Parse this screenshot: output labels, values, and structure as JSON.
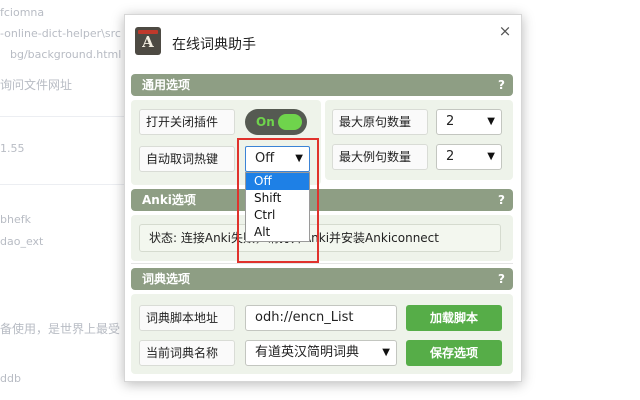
{
  "background": {
    "lines": [
      "fciomna",
      "-online-dict-helper\\src",
      "bg/background.html",
      "询问文件网址",
      "1.55",
      "bhefk",
      "dao_ext",
      "备使用，是世界上最受",
      "ddb"
    ]
  },
  "popup": {
    "title": "在线词典助手",
    "app_icon_letter": "A",
    "close_glyph": "×"
  },
  "general": {
    "title": "通用选项",
    "help": "?",
    "toggle_label": "打开关闭插件",
    "toggle_state": "On",
    "hotkey_label": "自动取词热键",
    "hotkey_value": "Off",
    "hotkey_options": [
      "Off",
      "Shift",
      "Ctrl",
      "Alt"
    ],
    "max_sense_label": "最大原句数量",
    "max_sense_value": "2",
    "max_example_label": "最大例句数量",
    "max_example_value": "2",
    "arrow_glyph": "▼"
  },
  "anki": {
    "title": "Anki选项",
    "help": "?",
    "status": "状态: 连接Anki失败，请打开Anki并安装Ankiconnect"
  },
  "dict": {
    "title": "词典选项",
    "help": "?",
    "script_label": "词典脚本地址",
    "script_value": "odh://encn_List",
    "load_button": "加载脚本",
    "current_label": "当前词典名称",
    "current_value": "有道英汉简明词典",
    "save_button": "保存选项"
  },
  "colors": {
    "section_bar": "#8e9e84",
    "panel_bg": "#eef3ea",
    "toggle_on": "#6fd44c",
    "button_green": "#56ad48",
    "dropdown_active": "#1e80e6",
    "highlight_red": "#e0322c"
  }
}
